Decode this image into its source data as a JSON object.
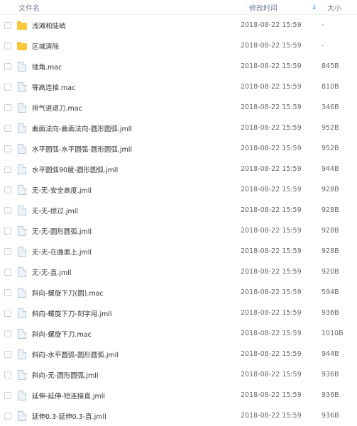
{
  "header": {
    "name_label": "文件名",
    "time_label": "修改时间",
    "size_label": "大小",
    "sort_icon": "arrow-down-icon",
    "accent": "#3b8cff"
  },
  "files": [
    {
      "name": "浅滩和陡峭",
      "time": "2018-08-22 15:59",
      "size": "-",
      "type": "folder"
    },
    {
      "name": "区域清除",
      "time": "2018-08-22 15:59",
      "size": "-",
      "type": "folder"
    },
    {
      "name": "插角.mac",
      "time": "2018-08-22 15:59",
      "size": "845B",
      "type": "file"
    },
    {
      "name": "等高连接.mac",
      "time": "2018-08-22 15:59",
      "size": "810B",
      "type": "file"
    },
    {
      "name": "排气进退刀.mac",
      "time": "2018-08-22 15:59",
      "size": "346B",
      "type": "file"
    },
    {
      "name": "曲面法向-曲面法向-圆形圆弧.jmll",
      "time": "2018-08-22 15:59",
      "size": "952B",
      "type": "file"
    },
    {
      "name": "水平圆弧-水平圆弧-圆形圆弧.jmll",
      "time": "2018-08-22 15:59",
      "size": "952B",
      "type": "file"
    },
    {
      "name": "水平圆弧90度-圆形圆弧.jmll",
      "time": "2018-08-22 15:59",
      "size": "944B",
      "type": "file"
    },
    {
      "name": "无-无-安全高度.jmll",
      "time": "2018-08-22 15:59",
      "size": "928B",
      "type": "file"
    },
    {
      "name": "无-无-掠过.jmll",
      "time": "2018-08-22 15:59",
      "size": "928B",
      "type": "file"
    },
    {
      "name": "无-无-圆形圆弧.jmll",
      "time": "2018-08-22 15:59",
      "size": "928B",
      "type": "file"
    },
    {
      "name": "无-无-在曲面上.jmll",
      "time": "2018-08-22 15:59",
      "size": "928B",
      "type": "file"
    },
    {
      "name": "无-无-直.jmll",
      "time": "2018-08-22 15:59",
      "size": "920B",
      "type": "file"
    },
    {
      "name": "斜向-螺旋下刀(圆).mac",
      "time": "2018-08-22 15:59",
      "size": "594B",
      "type": "file"
    },
    {
      "name": "斜向-螺旋下刀-刻字用.jmll",
      "time": "2018-08-22 15:59",
      "size": "936B",
      "type": "file"
    },
    {
      "name": "斜向-螺旋下刀.mac",
      "time": "2018-08-22 15:59",
      "size": "1010B",
      "type": "file"
    },
    {
      "name": "斜向-水平圆弧-圆形圆弧.jmll",
      "time": "2018-08-22 15:59",
      "size": "944B",
      "type": "file"
    },
    {
      "name": "斜向-无-圆形圆弧.jmll",
      "time": "2018-08-22 15:59",
      "size": "936B",
      "type": "file"
    },
    {
      "name": "延伸-延伸-短连接直.jmll",
      "time": "2018-08-22 15:59",
      "size": "936B",
      "type": "file"
    },
    {
      "name": "延伸0.3-延伸0.3-直.jmll",
      "time": "2018-08-22 15:59",
      "size": "936B",
      "type": "file"
    }
  ]
}
